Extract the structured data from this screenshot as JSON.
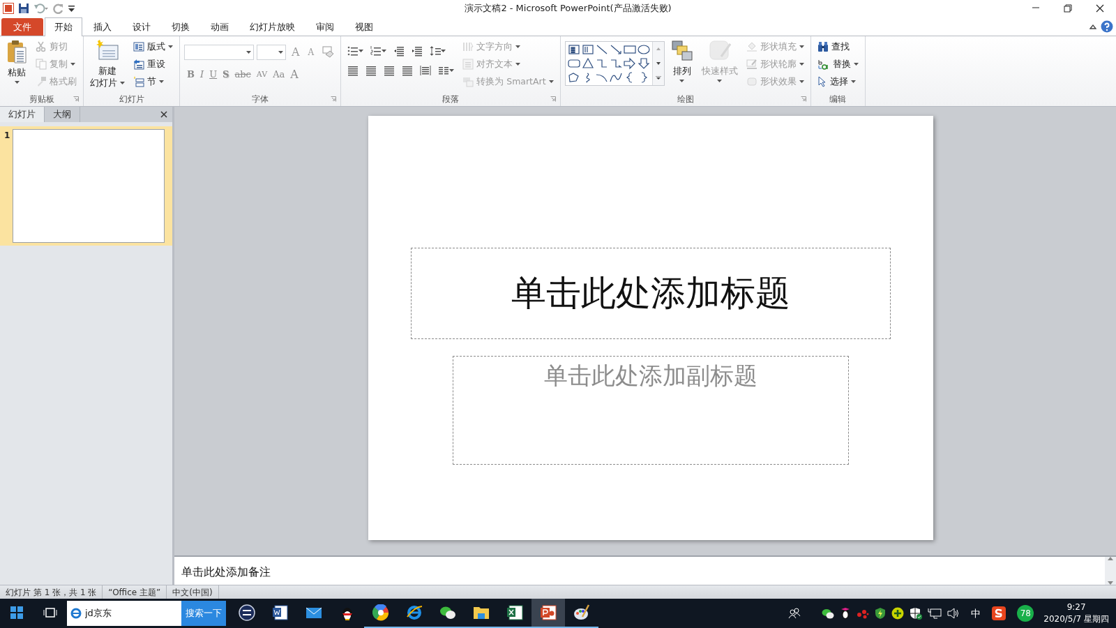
{
  "window": {
    "title": "演示文稿2  -  Microsoft PowerPoint(产品激活失败)"
  },
  "ribbon_tabs": [
    {
      "label": "文件",
      "kind": "file",
      "selected": false
    },
    {
      "label": "开始",
      "kind": "tab",
      "selected": true
    },
    {
      "label": "插入",
      "kind": "tab",
      "selected": false
    },
    {
      "label": "设计",
      "kind": "tab",
      "selected": false
    },
    {
      "label": "切换",
      "kind": "tab",
      "selected": false
    },
    {
      "label": "动画",
      "kind": "tab",
      "selected": false
    },
    {
      "label": "幻灯片放映",
      "kind": "tab",
      "selected": false
    },
    {
      "label": "审阅",
      "kind": "tab",
      "selected": false
    },
    {
      "label": "视图",
      "kind": "tab",
      "selected": false
    }
  ],
  "ribbon_groups": [
    {
      "label": "剪贴板",
      "launcher": true,
      "columns": [
        {
          "kind": "large",
          "items": [
            {
              "lines": [
                "粘贴"
              ],
              "dropdown": true,
              "disabled": false
            }
          ]
        },
        {
          "kind": "small",
          "items": [
            {
              "label": "剪切",
              "dropdown": false,
              "disabled": true
            },
            {
              "label": "复制",
              "dropdown": true,
              "disabled": true
            },
            {
              "label": "格式刷",
              "dropdown": false,
              "disabled": true
            }
          ]
        }
      ]
    },
    {
      "label": "幻灯片",
      "launcher": false,
      "columns": [
        {
          "kind": "large",
          "items": [
            {
              "lines": [
                "新建",
                "幻灯片"
              ],
              "dropdown": true,
              "disabled": false
            }
          ]
        },
        {
          "kind": "small",
          "items": [
            {
              "label": "版式",
              "dropdown": true,
              "disabled": false
            },
            {
              "label": "重设",
              "dropdown": false,
              "disabled": false
            },
            {
              "label": "节",
              "dropdown": true,
              "disabled": false
            }
          ]
        }
      ]
    },
    {
      "label": "字体",
      "launcher": true,
      "columns": [
        {
          "kind": "font",
          "disabled": true,
          "size_tools": [
            {
              "label": "A",
              "kind": "grow"
            },
            {
              "label": "A",
              "kind": "shrink"
            }
          ],
          "format_buttons": [
            {
              "label": "B",
              "kind": "bold"
            },
            {
              "label": "I",
              "kind": "italic"
            },
            {
              "label": "U",
              "kind": "underline"
            },
            {
              "label": "S",
              "kind": "shadow"
            },
            {
              "label": "abc",
              "kind": "strike"
            },
            {
              "label": "AV",
              "kind": "spacing"
            },
            {
              "label": "Aa",
              "kind": "case"
            },
            {
              "label": "A",
              "kind": "color"
            }
          ]
        }
      ]
    },
    {
      "label": "段落",
      "launcher": true,
      "columns": [
        {
          "kind": "paragraph"
        },
        {
          "kind": "small",
          "items": [
            {
              "label": "文字方向",
              "dropdown": true,
              "disabled": true
            },
            {
              "label": "对齐文本",
              "dropdown": true,
              "disabled": true
            },
            {
              "label": "转换为 SmartArt",
              "dropdown": true,
              "disabled": true
            }
          ]
        }
      ]
    },
    {
      "label": "绘图",
      "launcher": true,
      "columns": [
        {
          "kind": "shapes"
        },
        {
          "kind": "large",
          "items": [
            {
              "lines": [
                "排列"
              ],
              "dropdown": true,
              "disabled": false
            }
          ]
        },
        {
          "kind": "large",
          "items": [
            {
              "lines": [
                "快速样式"
              ],
              "dropdown": true,
              "disabled": true
            }
          ]
        },
        {
          "kind": "small",
          "items": [
            {
              "label": "形状填充",
              "dropdown": true,
              "disabled": true
            },
            {
              "label": "形状轮廓",
              "dropdown": true,
              "disabled": true
            },
            {
              "label": "形状效果",
              "dropdown": true,
              "disabled": true
            }
          ]
        }
      ]
    },
    {
      "label": "编辑",
      "launcher": false,
      "columns": [
        {
          "kind": "small",
          "items": [
            {
              "label": "查找",
              "dropdown": false,
              "disabled": false
            },
            {
              "label": "替换",
              "dropdown": true,
              "disabled": false
            },
            {
              "label": "选择",
              "dropdown": true,
              "disabled": false
            }
          ]
        }
      ]
    }
  ],
  "slide_pane": {
    "tabs": [
      {
        "label": "幻灯片",
        "selected": true
      },
      {
        "label": "大纲",
        "selected": false
      }
    ],
    "thumbnails": [
      {
        "number": "1",
        "selected": true
      }
    ]
  },
  "slide": {
    "title_placeholder": "单击此处添加标题",
    "subtitle_placeholder": "单击此处添加副标题"
  },
  "notes": {
    "placeholder": "单击此处添加备注"
  },
  "status_bar": {
    "items": [
      "幻灯片 第 1 张，共 1 张",
      "“Office 主题”",
      "中文(中国)"
    ]
  },
  "taskbar": {
    "search": {
      "value": "jd京东",
      "button": "搜索一下"
    },
    "apps": [
      {
        "kind": "round-logo",
        "running": false,
        "selected": false
      },
      {
        "kind": "word",
        "running": false,
        "selected": false
      },
      {
        "kind": "mail",
        "running": false,
        "selected": false
      },
      {
        "kind": "penguin",
        "running": false,
        "selected": false
      },
      {
        "kind": "color-wheel",
        "running": true,
        "selected": false
      },
      {
        "kind": "browser",
        "running": true,
        "selected": false
      },
      {
        "kind": "chat",
        "running": true,
        "selected": false
      },
      {
        "kind": "folder",
        "running": true,
        "selected": false
      },
      {
        "kind": "sheet",
        "running": true,
        "selected": false
      },
      {
        "kind": "slides",
        "running": true,
        "selected": true
      },
      {
        "kind": "palette",
        "running": true,
        "selected": false
      }
    ],
    "tray": {
      "ime": "中",
      "badge": "78",
      "time": "9:27",
      "date": "2020/5/7 星期四"
    }
  }
}
